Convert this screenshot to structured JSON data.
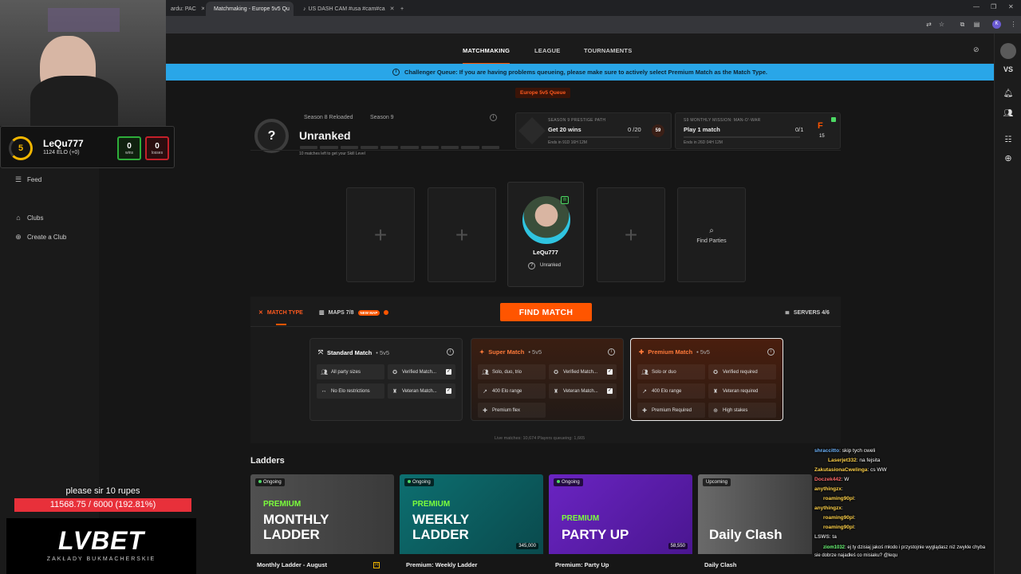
{
  "browser": {
    "tabs": [
      {
        "label": "ardu: PAC",
        "active": false
      },
      {
        "label": "Matchmaking - Europe 5v5 Qu",
        "active": true
      },
      {
        "label": "US DASH CAM #usa #cam#ca",
        "active": false
      }
    ],
    "new_tab": "+",
    "profile_initial": "K"
  },
  "nav": {
    "links": [
      "MATCHMAKING",
      "LEAGUE",
      "TOURNAMENTS"
    ],
    "active": "MATCHMAKING"
  },
  "banner": "Challenger Queue: If you are having problems queueing, please make sure to actively select Premium Match as the Match Type.",
  "queue_label": "Europe 5v5 Queue",
  "sidebar": {
    "items": [
      {
        "label": "Feed",
        "icon": "feed-icon"
      },
      {
        "label": "Clubs",
        "icon": "clubs-icon"
      },
      {
        "label": "Create a Club",
        "icon": "plus-circle-icon"
      }
    ]
  },
  "rank": {
    "badge": "?",
    "season_tabs": [
      "Season 8 Reloaded",
      "Season 9"
    ],
    "title": "Unranked",
    "note": "10 matches left to get your Skill Level"
  },
  "missions": [
    {
      "kicker": "SEASON 9 PRESTIGE PATH",
      "goal": "Get 20 wins",
      "progress": "0 /20",
      "badge": "59",
      "ends": "Ends in 91D 16H 12M"
    },
    {
      "kicker": "S9 MONTHLY MISSION: MAN-O'-WAR",
      "goal": "Play 1 match",
      "progress": "0/1",
      "badge": "15",
      "ends": "Ends in 26D 04H 12M"
    }
  ],
  "lobby": {
    "add_symbol": "+",
    "find_parties": "Find Parties",
    "player": {
      "name": "LeQu777",
      "rank": "Unranked",
      "rank_badge": "?"
    }
  },
  "controls": {
    "match_type": "MATCH TYPE",
    "maps": "MAPS 7/8",
    "new_map": "NEW MAP",
    "find_match": "FIND MATCH",
    "servers": "SERVERS 4/6"
  },
  "match_types": [
    {
      "name": "Standard Match",
      "format": "• 5v5",
      "features": [
        {
          "label": "All party sizes",
          "icon": "party-icon",
          "check": false
        },
        {
          "label": "Verified Match...",
          "icon": "verified-icon",
          "check": true
        },
        {
          "label": "No Elo restrictions",
          "icon": "swap-icon",
          "check": false
        },
        {
          "label": "Veteran Match...",
          "icon": "veteran-icon",
          "check": true
        }
      ]
    },
    {
      "name": "Super Match",
      "format": "• 5v5",
      "features": [
        {
          "label": "Solo, duo, trio",
          "icon": "party-icon",
          "check": false
        },
        {
          "label": "Verified Match...",
          "icon": "verified-icon",
          "check": true
        },
        {
          "label": "400 Elo range",
          "icon": "trend-icon",
          "check": false
        },
        {
          "label": "Veteran Match...",
          "icon": "veteran-icon",
          "check": true
        },
        {
          "label": "Premium flex",
          "icon": "premium-icon",
          "check": false
        }
      ]
    },
    {
      "name": "Premium Match",
      "format": "• 5v5",
      "features": [
        {
          "label": "Solo or duo",
          "icon": "party-icon",
          "check": false
        },
        {
          "label": "Verified required",
          "icon": "verified-icon",
          "check": false
        },
        {
          "label": "400 Elo range",
          "icon": "trend-icon",
          "check": false
        },
        {
          "label": "Veteran required",
          "icon": "veteran-icon",
          "check": false
        },
        {
          "label": "Premium Required",
          "icon": "premium-icon",
          "check": false
        },
        {
          "label": "High stakes",
          "icon": "target-icon",
          "check": false
        }
      ]
    }
  ],
  "live_stats": "Live matches: 10,674     Players queueing: 1,665",
  "ladders": {
    "title": "Ladders",
    "items": [
      {
        "status": "Ongoing",
        "premium": "PREMIUM",
        "big1": "MONTHLY",
        "big2": "LADDER",
        "name": "Monthly Ladder - August",
        "pool": "",
        "bg": "#4b4b4b"
      },
      {
        "status": "Ongoing",
        "premium": "PREMIUM",
        "big1": "WEEKLY",
        "big2": "LADDER",
        "name": "Premium: Weekly Ladder",
        "pool": "345,000",
        "bg": "#0e6b6b"
      },
      {
        "status": "Ongoing",
        "premium": "PREMIUM",
        "big1": "PARTY UP",
        "big2": "",
        "name": "Premium: Party Up",
        "pool": "58,550",
        "bg": "#5a1fa8"
      },
      {
        "status": "Upcoming",
        "premium": "",
        "big1": "Daily Clash",
        "big2": "",
        "name": "Daily Clash",
        "pool": "",
        "bg": "#5a5a5a"
      }
    ]
  },
  "stream": {
    "faceit": {
      "level": "5",
      "name": "LeQu777",
      "elo": "1124 ELO (+0)",
      "wins": "0",
      "wins_label": "wins",
      "losses": "0",
      "losses_label": "losses"
    },
    "donation_msg": "please sir 10 rupes",
    "donation_progress": "11568.75 / 6000 (192.81%)",
    "donation_fraction": 1.0,
    "sponsor": "LVBET",
    "sponsor_sub": "ZAKŁADY BUKMACHERSKIE",
    "chat": [
      {
        "user": "shraccitto",
        "text": ": skip tych cweli",
        "color": "#6fb6ff"
      },
      {
        "user": "Laserjet332",
        "text": ": na fejsita",
        "color": "#ffd24a"
      },
      {
        "user": "ZakutasionaCwelinga",
        "text": ": cs WW",
        "color": "#ffd24a"
      },
      {
        "user": "Doczek442",
        "text": ": W",
        "color": "#ff6a6a"
      },
      {
        "user": "anythingzx",
        "text": ":",
        "color": "#ffd24a"
      },
      {
        "user": "roaming90pl",
        "text": ":",
        "color": "#ffd24a"
      },
      {
        "user": "anythingzx",
        "text": ":",
        "color": "#ffd24a"
      },
      {
        "user": "roaming90pl",
        "text": ":",
        "color": "#ffd24a"
      },
      {
        "user": "roaming90pl",
        "text": ":",
        "color": "#ffd24a"
      },
      {
        "user": "LSWS",
        "text": ": ta",
        "color": "#c6c6c6"
      },
      {
        "user": "ziom1032",
        "text": ": ej ty dzisiaj jakoś młodo i przystojnie wyglądasz niż zwykle chyba",
        "color": "#6fff7a"
      },
      {
        "user": "",
        "text": "sie dobrze najadłeś co misiaku? @lequ",
        "color": "#ffffff"
      }
    ]
  }
}
